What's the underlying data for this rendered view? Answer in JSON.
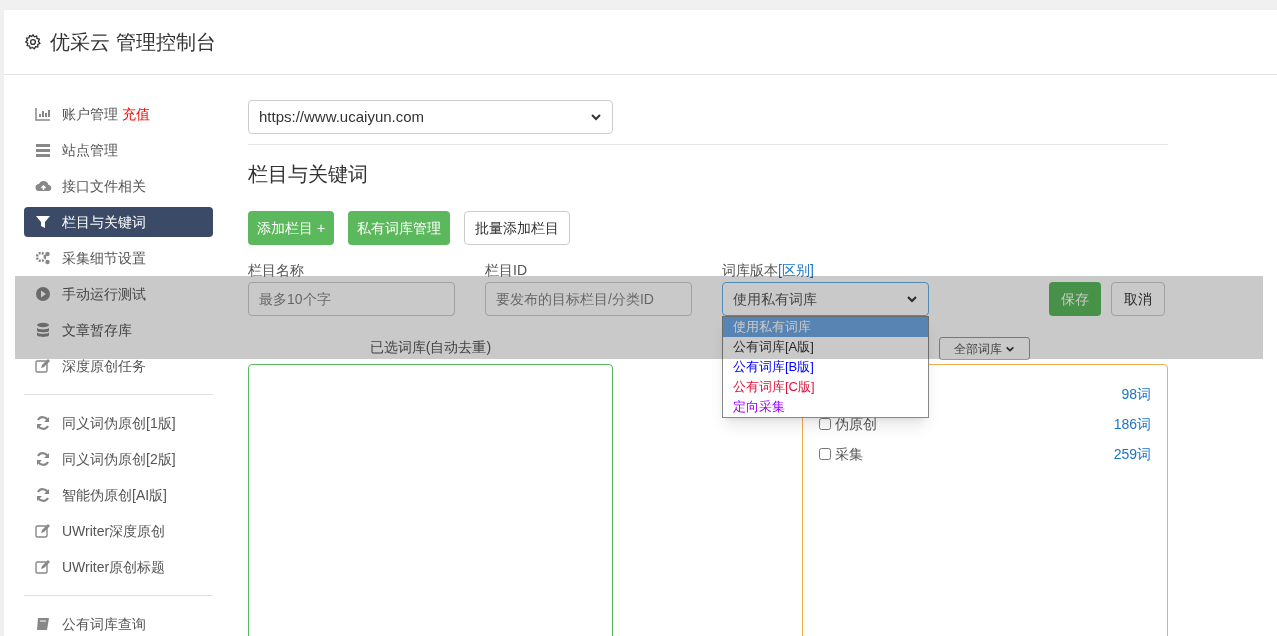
{
  "header": {
    "title": "优采云 管理控制台"
  },
  "sidebar": {
    "groups": [
      {
        "items": [
          {
            "kind": "bars",
            "label": "账户管理",
            "badge": "充值",
            "selected": false
          },
          {
            "kind": "server",
            "label": "站点管理",
            "selected": false
          },
          {
            "kind": "cloud",
            "label": "接口文件相关",
            "selected": false
          },
          {
            "kind": "filter",
            "label": "栏目与关键词",
            "selected": true
          },
          {
            "kind": "gears",
            "label": "采集细节设置",
            "selected": false
          },
          {
            "kind": "play",
            "label": "手动运行测试",
            "selected": false
          },
          {
            "kind": "database",
            "label": "文章暂存库",
            "selected": false
          },
          {
            "kind": "edit",
            "label": "深度原创任务",
            "selected": false
          }
        ]
      },
      {
        "items": [
          {
            "kind": "refresh",
            "label": "同义词伪原创[1版]",
            "selected": false
          },
          {
            "kind": "refresh",
            "label": "同义词伪原创[2版]",
            "selected": false
          },
          {
            "kind": "refresh",
            "label": "智能伪原创[AI版]",
            "selected": false
          },
          {
            "kind": "edit",
            "label": "UWriter深度原创",
            "selected": false
          },
          {
            "kind": "edit",
            "label": "UWriter原创标题",
            "selected": false
          }
        ]
      },
      {
        "items": [
          {
            "kind": "book",
            "label": "公有词库查询",
            "selected": false
          }
        ]
      }
    ]
  },
  "site_select": {
    "value": "https://www.ucaiyun.com"
  },
  "section_title": "栏目与关键词",
  "toolbar": [
    {
      "label": "添加栏目 +",
      "kind": "primary"
    },
    {
      "label": "私有词库管理",
      "kind": "primary"
    },
    {
      "label": "批量添加栏目",
      "kind": "default"
    }
  ],
  "form": {
    "name": {
      "label": "栏目名称",
      "placeholder": "最多10个字"
    },
    "id": {
      "label": "栏目ID",
      "placeholder": "要发布的目标栏目/分类ID"
    },
    "version": {
      "label": "词库版本",
      "link": "[区别]",
      "value": "使用私有词库",
      "options": [
        {
          "label": "使用私有词库",
          "selected": true
        },
        {
          "label": "公有词库[A版]",
          "color": "#333333",
          "selected": false
        },
        {
          "label": "公有词库[B版]",
          "color": "#0000ff",
          "selected": false
        },
        {
          "label": "公有词库[C版]",
          "color": "#dc143c",
          "selected": false
        },
        {
          "label": "定向采集",
          "color": "#9900ff",
          "selected": false
        }
      ]
    },
    "save": "保存",
    "cancel": "取消"
  },
  "selected_panel": {
    "title": "已选词库(自动去重)"
  },
  "library_panel": {
    "filter": "全部词库",
    "rows": [
      {
        "count": "98词"
      },
      {
        "label": "伪原创",
        "count": "186词",
        "checked": false
      },
      {
        "label": "采集",
        "count": "259词",
        "checked": false
      }
    ]
  }
}
